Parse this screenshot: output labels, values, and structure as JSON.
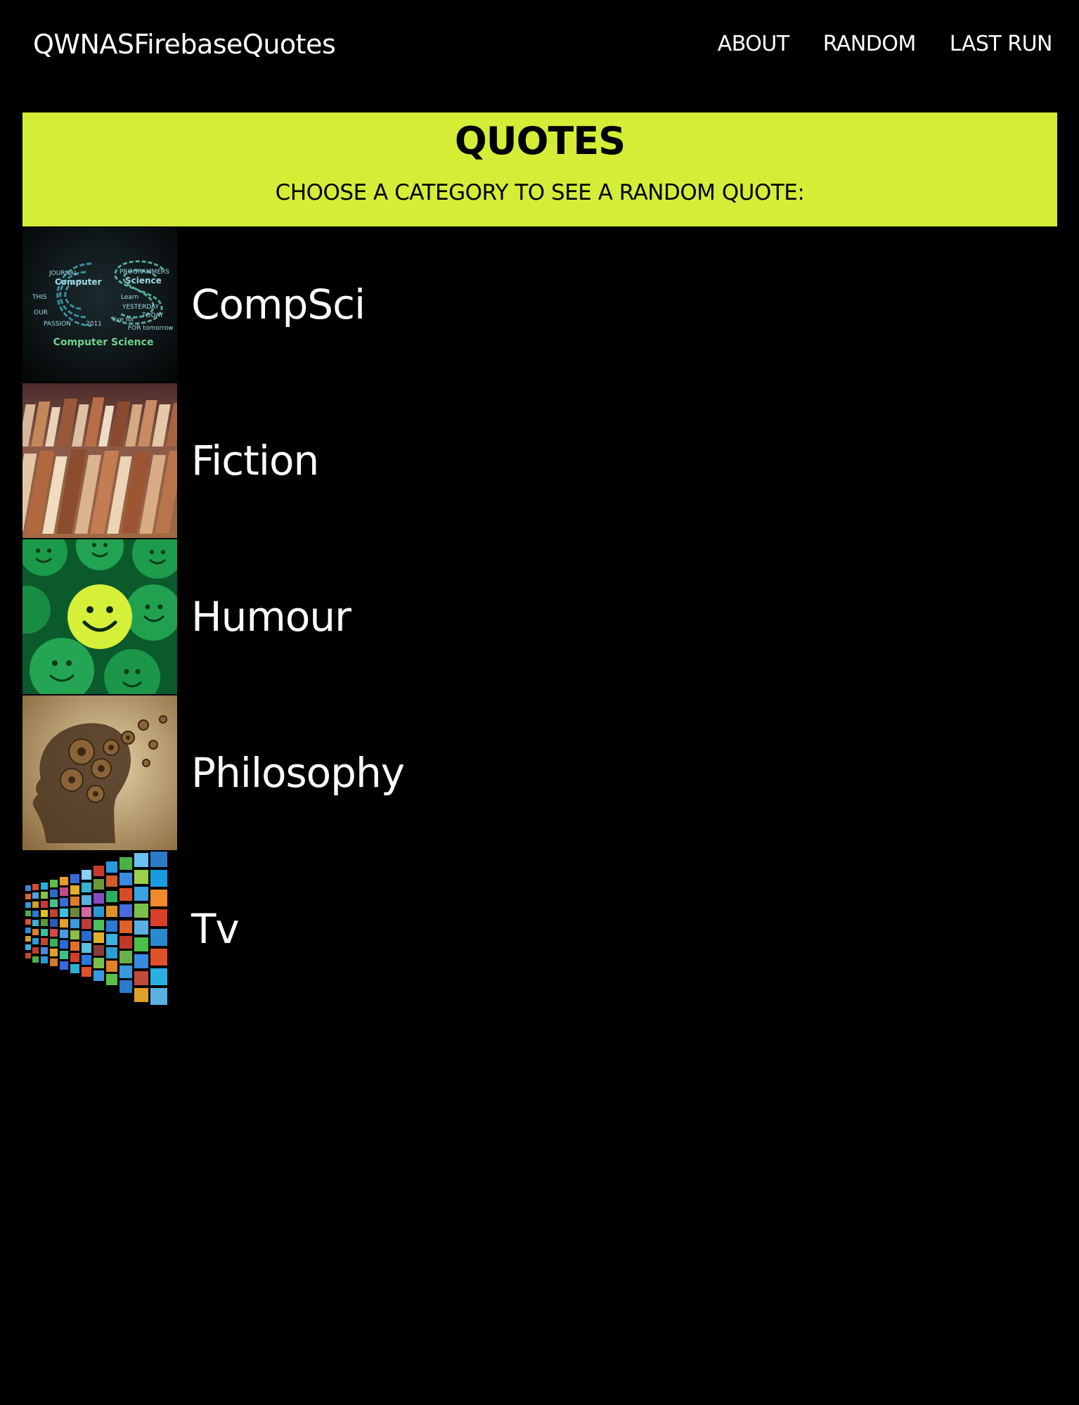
{
  "navbar": {
    "brand": "QWNASFirebaseQuotes",
    "links": [
      "ABOUT",
      "RANDOM",
      "LAST RUN"
    ]
  },
  "hero": {
    "title": "QUOTES",
    "subtitle": "CHOOSE A CATEGORY TO SEE A RANDOM QUOTE:"
  },
  "categories": [
    {
      "label": "CompSci",
      "image": "computer-science-word-cloud",
      "image_caption": "Computer Science"
    },
    {
      "label": "Fiction",
      "image": "stacked-old-books"
    },
    {
      "label": "Humour",
      "image": "smiley-face-balls"
    },
    {
      "label": "Philosophy",
      "image": "gears-head-silhouette"
    },
    {
      "label": "Tv",
      "image": "wall-of-tv-screens"
    }
  ],
  "colors": {
    "background": "#000000",
    "accent": "#d4ee38",
    "text": "#ffffff"
  }
}
